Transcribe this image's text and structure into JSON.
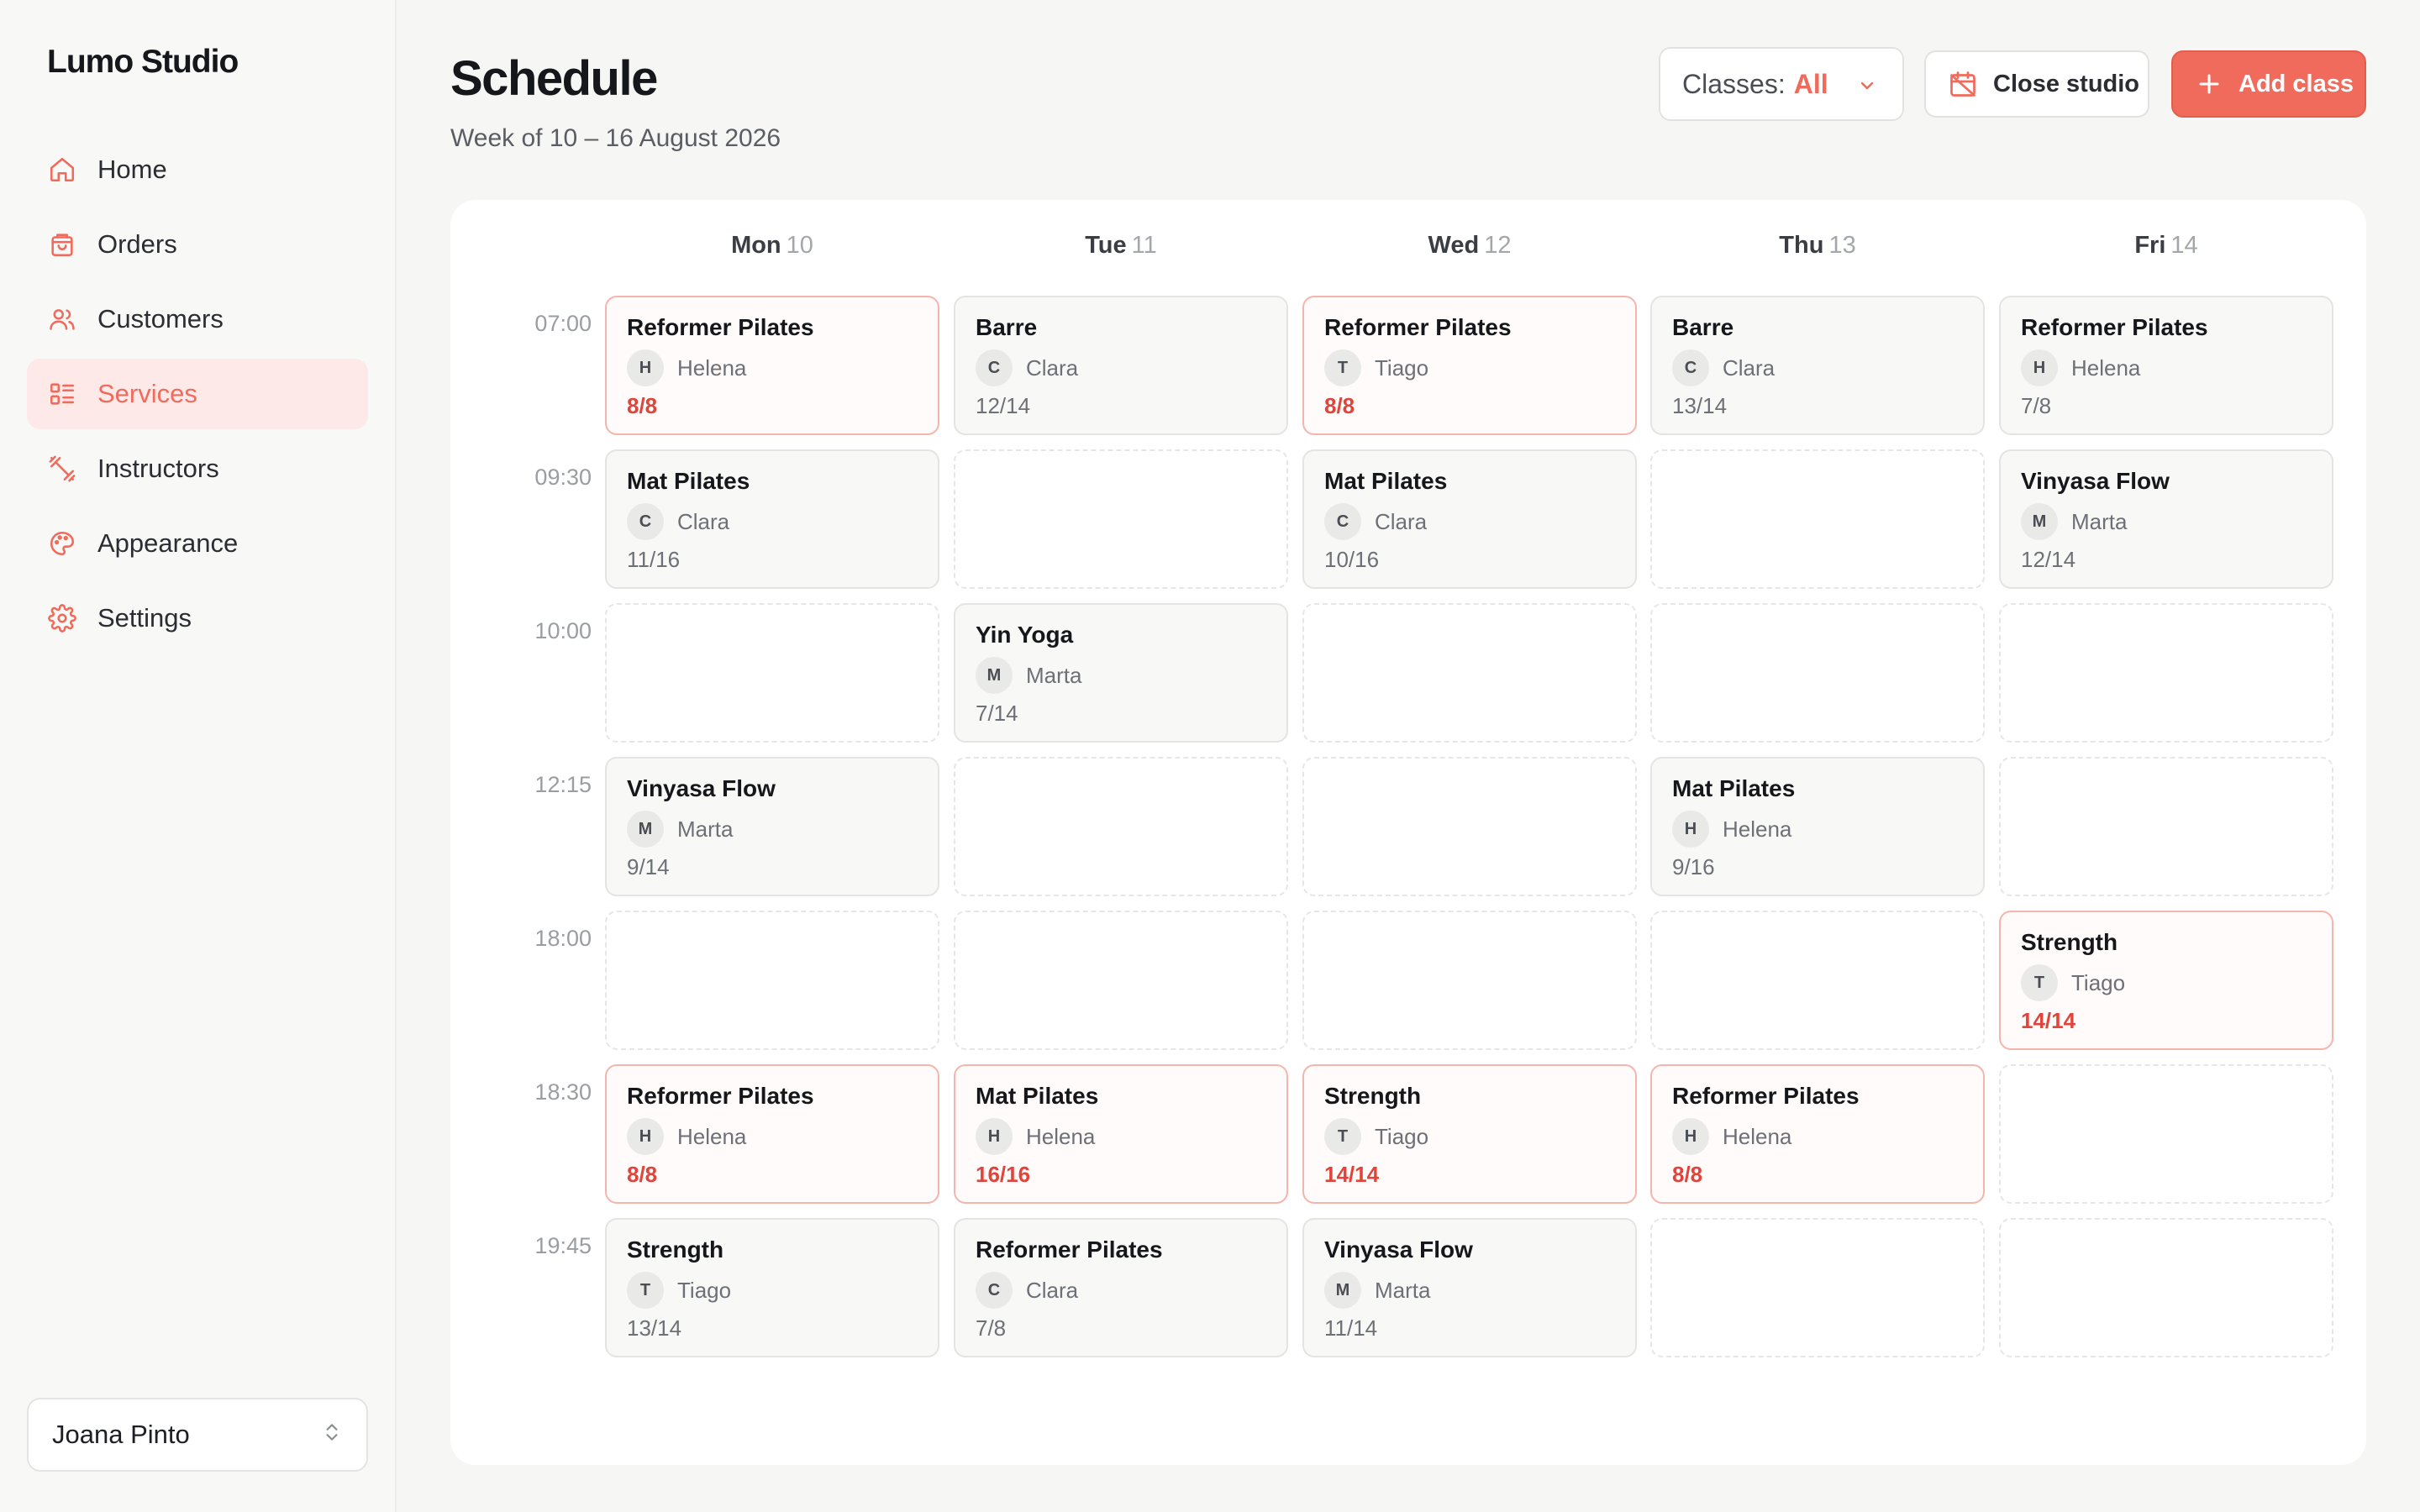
{
  "sidebar": {
    "brand": "Lumo Studio",
    "items": [
      {
        "label": "Home",
        "icon": "home-icon"
      },
      {
        "label": "Orders",
        "icon": "bag-icon"
      },
      {
        "label": "Customers",
        "icon": "users-icon"
      },
      {
        "label": "Services",
        "icon": "list-icon",
        "active": true
      },
      {
        "label": "Instructors",
        "icon": "dumbbell-icon"
      },
      {
        "label": "Appearance",
        "icon": "palette-icon"
      },
      {
        "label": "Settings",
        "icon": "gear-icon"
      }
    ],
    "user": "Joana Pinto"
  },
  "header": {
    "title": "Schedule",
    "subtitle": "Week of 10 – 16 August 2026",
    "filter_label": "Classes:",
    "filter_value": "All",
    "close_label": "Close studio",
    "add_label": "Add class"
  },
  "colors": {
    "accent": "#f06b5b",
    "full": "#e0443a"
  },
  "days": [
    {
      "name": "Mon",
      "num": "10"
    },
    {
      "name": "Tue",
      "num": "11"
    },
    {
      "name": "Wed",
      "num": "12"
    },
    {
      "name": "Thu",
      "num": "13"
    },
    {
      "name": "Fri",
      "num": "14"
    }
  ],
  "times": [
    "07:00",
    "09:30",
    "10:00",
    "12:15",
    "18:00",
    "18:30",
    "19:45"
  ],
  "grid": [
    [
      {
        "name": "Reformer Pilates",
        "initial": "H",
        "instructor": "Helena",
        "capacity": "8/8",
        "full": true
      },
      {
        "name": "Barre",
        "initial": "C",
        "instructor": "Clara",
        "capacity": "12/14"
      },
      {
        "name": "Reformer Pilates",
        "initial": "T",
        "instructor": "Tiago",
        "capacity": "8/8",
        "full": true
      },
      {
        "name": "Barre",
        "initial": "C",
        "instructor": "Clara",
        "capacity": "13/14"
      },
      {
        "name": "Reformer Pilates",
        "initial": "H",
        "instructor": "Helena",
        "capacity": "7/8"
      }
    ],
    [
      {
        "name": "Mat Pilates",
        "initial": "C",
        "instructor": "Clara",
        "capacity": "11/16"
      },
      null,
      {
        "name": "Mat Pilates",
        "initial": "C",
        "instructor": "Clara",
        "capacity": "10/16"
      },
      null,
      {
        "name": "Vinyasa Flow",
        "initial": "M",
        "instructor": "Marta",
        "capacity": "12/14"
      }
    ],
    [
      null,
      {
        "name": "Yin Yoga",
        "initial": "M",
        "instructor": "Marta",
        "capacity": "7/14"
      },
      null,
      null,
      null
    ],
    [
      {
        "name": "Vinyasa Flow",
        "initial": "M",
        "instructor": "Marta",
        "capacity": "9/14"
      },
      null,
      null,
      {
        "name": "Mat Pilates",
        "initial": "H",
        "instructor": "Helena",
        "capacity": "9/16"
      },
      null
    ],
    [
      null,
      null,
      null,
      null,
      {
        "name": "Strength",
        "initial": "T",
        "instructor": "Tiago",
        "capacity": "14/14",
        "full": true
      }
    ],
    [
      {
        "name": "Reformer Pilates",
        "initial": "H",
        "instructor": "Helena",
        "capacity": "8/8",
        "full": true
      },
      {
        "name": "Mat Pilates",
        "initial": "H",
        "instructor": "Helena",
        "capacity": "16/16",
        "full": true
      },
      {
        "name": "Strength",
        "initial": "T",
        "instructor": "Tiago",
        "capacity": "14/14",
        "full": true
      },
      {
        "name": "Reformer Pilates",
        "initial": "H",
        "instructor": "Helena",
        "capacity": "8/8",
        "full": true
      },
      null
    ],
    [
      {
        "name": "Strength",
        "initial": "T",
        "instructor": "Tiago",
        "capacity": "13/14"
      },
      {
        "name": "Reformer Pilates",
        "initial": "C",
        "instructor": "Clara",
        "capacity": "7/8"
      },
      {
        "name": "Vinyasa Flow",
        "initial": "M",
        "instructor": "Marta",
        "capacity": "11/14"
      },
      null,
      null
    ]
  ]
}
